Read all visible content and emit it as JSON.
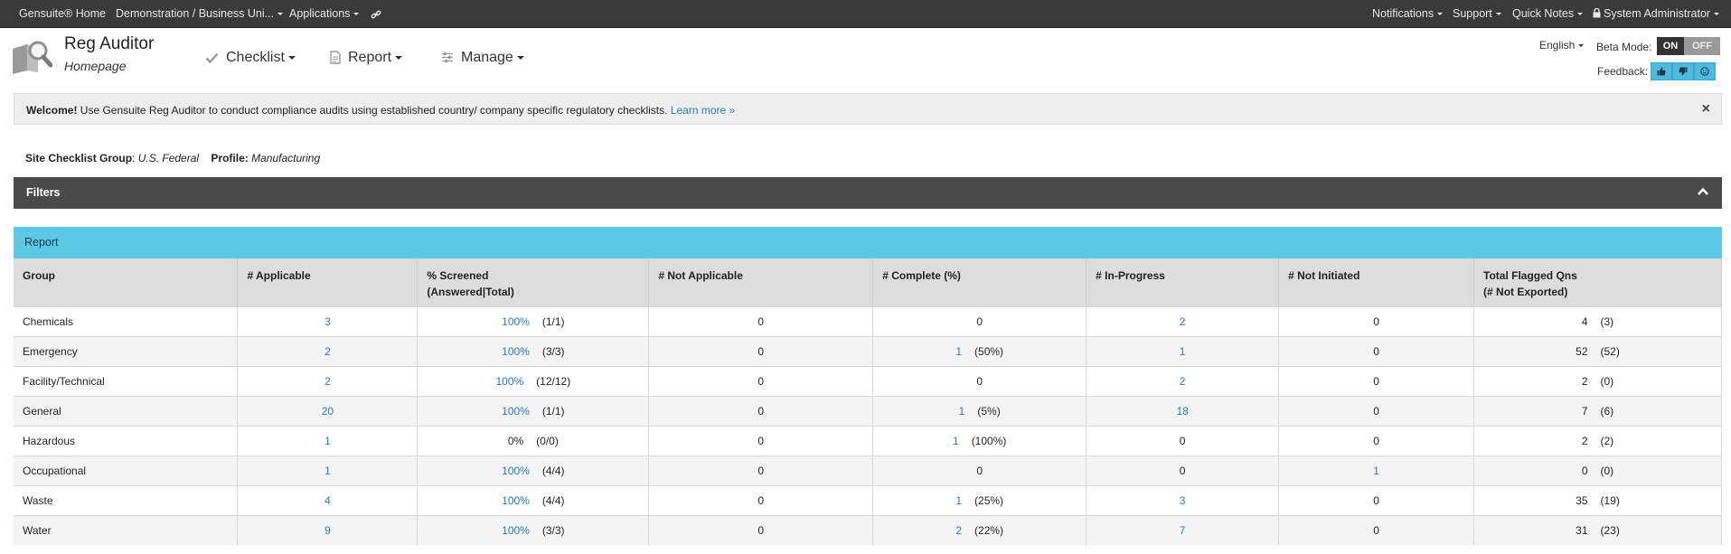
{
  "topbar": {
    "home": "Gensuite® Home",
    "org": "Demonstration / Business Uni...",
    "applications": "Applications",
    "notifications": "Notifications",
    "support": "Support",
    "quick_notes": "Quick Notes",
    "user": "System Administrator"
  },
  "header": {
    "title": "Reg Auditor",
    "subtitle": "Homepage",
    "menus": {
      "checklist": "Checklist",
      "report": "Report",
      "manage": "Manage"
    },
    "language": "English",
    "beta_label": "Beta Mode:",
    "beta_on": "ON",
    "beta_off": "OFF",
    "feedback_label": "Feedback:"
  },
  "welcome": {
    "bold": "Welcome!",
    "text": " Use Gensuite Reg Auditor to conduct compliance audits using established country/ company specific regulatory checklists. ",
    "link": "Learn more »",
    "close": "×"
  },
  "site": {
    "group_label": "Site Checklist Group",
    "group_value": "U.S. Federal",
    "profile_label": "Profile:",
    "profile_value": "Manufacturing"
  },
  "filters": {
    "title": "Filters"
  },
  "report": {
    "title": "Report",
    "columns": [
      {
        "line1": "Group",
        "line2": ""
      },
      {
        "line1": "# Applicable",
        "line2": ""
      },
      {
        "line1": "% Screened",
        "line2": "(Answered|Total)"
      },
      {
        "line1": "# Not Applicable",
        "line2": ""
      },
      {
        "line1": "# Complete (%)",
        "line2": ""
      },
      {
        "line1": "# In-Progress",
        "line2": ""
      },
      {
        "line1": "# Not Initiated",
        "line2": ""
      },
      {
        "line1": "Total Flagged Qns",
        "line2": "(# Not Exported)"
      }
    ],
    "rows": [
      {
        "group": "Chemicals",
        "applicable": "3",
        "screened": "100%",
        "screened_detail": "(1/1)",
        "not_applicable": "0",
        "complete": "0",
        "complete_pct": "",
        "in_progress": "2",
        "not_initiated": "0",
        "flagged": "4",
        "flagged_ne": "(3)"
      },
      {
        "group": "Emergency",
        "applicable": "2",
        "screened": "100%",
        "screened_detail": "(3/3)",
        "not_applicable": "0",
        "complete": "1",
        "complete_pct": "(50%)",
        "in_progress": "1",
        "not_initiated": "0",
        "flagged": "52",
        "flagged_ne": "(52)"
      },
      {
        "group": "Facility/Technical",
        "applicable": "2",
        "screened": "100%",
        "screened_detail": "(12/12)",
        "not_applicable": "0",
        "complete": "0",
        "complete_pct": "",
        "in_progress": "2",
        "not_initiated": "0",
        "flagged": "2",
        "flagged_ne": "(0)"
      },
      {
        "group": "General",
        "applicable": "20",
        "screened": "100%",
        "screened_detail": "(1/1)",
        "not_applicable": "0",
        "complete": "1",
        "complete_pct": "(5%)",
        "in_progress": "18",
        "not_initiated": "0",
        "flagged": "7",
        "flagged_ne": "(6)"
      },
      {
        "group": "Hazardous",
        "applicable": "1",
        "screened": "0%",
        "screened_detail": "(0/0)",
        "not_applicable": "0",
        "complete": "1",
        "complete_pct": "(100%)",
        "in_progress": "0",
        "not_initiated": "0",
        "flagged": "2",
        "flagged_ne": "(2)"
      },
      {
        "group": "Occupational",
        "applicable": "1",
        "screened": "100%",
        "screened_detail": "(4/4)",
        "not_applicable": "0",
        "complete": "0",
        "complete_pct": "",
        "in_progress": "0",
        "not_initiated": "1",
        "flagged": "0",
        "flagged_ne": "(0)"
      },
      {
        "group": "Waste",
        "applicable": "4",
        "screened": "100%",
        "screened_detail": "(4/4)",
        "not_applicable": "0",
        "complete": "1",
        "complete_pct": "(25%)",
        "in_progress": "3",
        "not_initiated": "0",
        "flagged": "35",
        "flagged_ne": "(19)"
      },
      {
        "group": "Water",
        "applicable": "9",
        "screened": "100%",
        "screened_detail": "(3/3)",
        "not_applicable": "0",
        "complete": "2",
        "complete_pct": "(22%)",
        "in_progress": "7",
        "not_initiated": "0",
        "flagged": "31",
        "flagged_ne": "(23)"
      }
    ]
  },
  "colors": {
    "topbar": "#3a3a3a",
    "link": "#2a7ab0",
    "report_header": "#5bc8e6",
    "filters_bar": "#4a4a4a"
  }
}
